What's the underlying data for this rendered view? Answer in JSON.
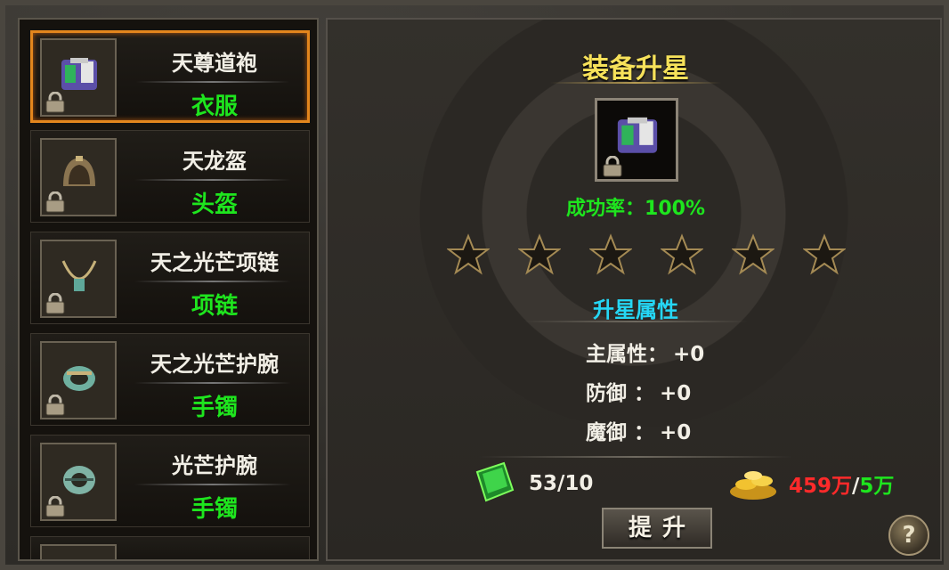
{
  "list": {
    "items": [
      {
        "name": "天尊道袍",
        "type": "衣服",
        "selected": true,
        "icon": "robe-icon"
      },
      {
        "name": "天龙盔",
        "type": "头盔",
        "selected": false,
        "icon": "helmet-icon"
      },
      {
        "name": "天之光芒项链",
        "type": "项链",
        "selected": false,
        "icon": "necklace-icon"
      },
      {
        "name": "天之光芒护腕",
        "type": "手镯",
        "selected": false,
        "icon": "bracelet-icon"
      },
      {
        "name": "光芒护腕",
        "type": "手镯",
        "selected": false,
        "icon": "bracelet-icon"
      }
    ]
  },
  "panel": {
    "title": "装备升星",
    "success_rate": "成功率：100%",
    "stars_filled": 0,
    "stars_total": 6,
    "section_title": "升星属性",
    "attributes": [
      {
        "label": "主属性：",
        "value": "+0"
      },
      {
        "label": "防御 ：",
        "value": "+0"
      },
      {
        "label": "魔御 ：",
        "value": "+0"
      }
    ],
    "stone_count": "53/10",
    "gold_current": "459万",
    "gold_sep": "/",
    "gold_required": "5万",
    "upgrade_label": "提升",
    "help_label": "?"
  },
  "colors": {
    "accent_orange": "#e3861d",
    "type_green": "#1ee51e",
    "title_yellow": "#f6e15a",
    "section_cyan": "#25d7f5",
    "gold_red": "#ff2a2a"
  }
}
